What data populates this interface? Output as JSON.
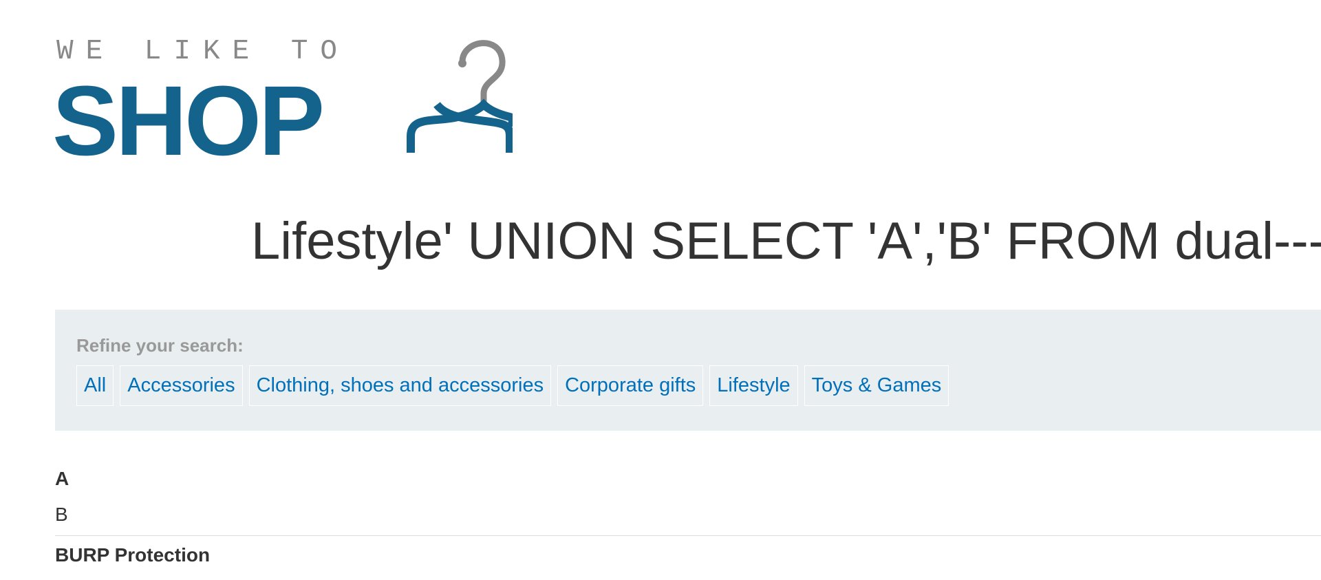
{
  "logo": {
    "tagline": "WE LIKE TO",
    "wordmark": "SHOP",
    "icon": "hanger-icon",
    "colors": {
      "wordmark": "#14638c",
      "tagline": "#888888"
    }
  },
  "heading": {
    "title": "Lifestyle' UNION SELECT 'A','B' FROM dual----"
  },
  "filters": {
    "label": "Refine your search:",
    "items": [
      "All",
      "Accessories",
      "Clothing, shoes and accessories",
      "Corporate gifts",
      "Lifestyle",
      "Toys & Games"
    ],
    "link_color": "#0070bb",
    "panel_color": "#e9eef1"
  },
  "results": [
    {
      "header": "A",
      "body": "B"
    },
    {
      "header": "BURP Protection",
      "body": ""
    }
  ]
}
